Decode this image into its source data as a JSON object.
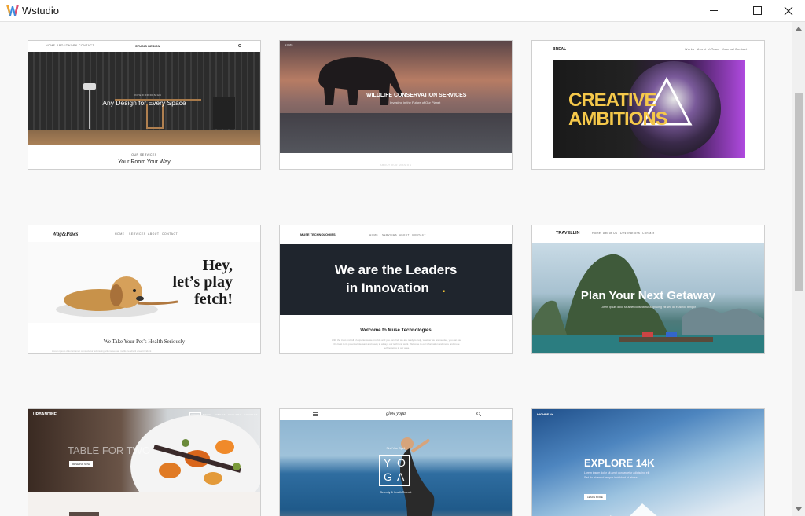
{
  "window": {
    "title": "Wstudio"
  },
  "templates": [
    {
      "nav": [
        "HOME",
        "ABOUT",
        "WORK",
        "CONTACT"
      ],
      "brand": "STUDIO DESIGN",
      "hero_kicker": "INTERIOR DESIGN",
      "hero_title": "Any Design for Every Space",
      "section_kicker": "OUR SERVICES",
      "section_title": "Your Room Your Way"
    },
    {
      "brand": "HOME",
      "hero_title": "WILDLIFE CONSERVATION SERVICES",
      "hero_subtitle": "Investing in the Future of Our Planet",
      "footer": "ABOUT OUR MISSION"
    },
    {
      "brand": "BREAL",
      "nav": [
        "Works",
        "About Us",
        "Team",
        "Journal",
        "Contact"
      ],
      "hero_line1": "CREATIVE",
      "hero_line2": "AMBITIONS"
    },
    {
      "brand": "Wag&Paws",
      "nav": [
        "HOME",
        "SERVICES",
        "ABOUT",
        "CONTACT"
      ],
      "hero_line1": "Hey,",
      "hero_line2": "let’s play",
      "hero_line3": "fetch!",
      "section_title": "We Take Your Pet’s Health Seriously",
      "section_body": "Lorem ipsum dolor sit amet consectetur adipiscing elit consequat mollis hendrerit vitae tincidunt"
    },
    {
      "brand": "MUSE TECHNOLOGIES",
      "nav": [
        "HOME",
        "SERVICES",
        "ABOUT",
        "CONTACT"
      ],
      "hero_line1": "We are the Leaders",
      "hero_line2": "in Innovation",
      "hero_dot": ".",
      "section_title": "Welcome to Muse Technologies",
      "section_body": "With the trust and full of experience we provide and you can find, we are ready to help, whether we are needed, you can use the best to its potential pleasant and ready to always our technical work. Welcome to our information and more and more technologies in our area."
    },
    {
      "brand": "TRAVELLIN",
      "nav": [
        "Home",
        "About Us",
        "Destinations",
        "Contact"
      ],
      "hero_title": "Plan Your Next Getaway",
      "hero_subtitle": "Lorem ipsum dolor sit amet consectetur adipiscing elit sed do eiusmod tempor"
    },
    {
      "brand": "URBANDINE",
      "nav": [
        "HOME",
        "MENU",
        "ABOUT",
        "GALLERY",
        "CONTACT"
      ],
      "hero_title": "TABLE FOR TWO",
      "hero_button": "RESERVE NOW"
    },
    {
      "brand": "glow yoga",
      "hero_letters": [
        "Y",
        "O",
        "G",
        "A"
      ],
      "hero_caption": "Find Your Spirit",
      "hero_subtitle": "Serenity & Health Retreat"
    },
    {
      "brand": "HIGHPEAK",
      "hero_title": "EXPLORE 14K",
      "hero_subtitle": "Lorem ipsum dolor sit amet consectetur adipiscing elit",
      "hero_subtitle2": "Sed do eiusmod tempor incididunt ut labore",
      "hero_button": "LEARN MORE"
    }
  ]
}
